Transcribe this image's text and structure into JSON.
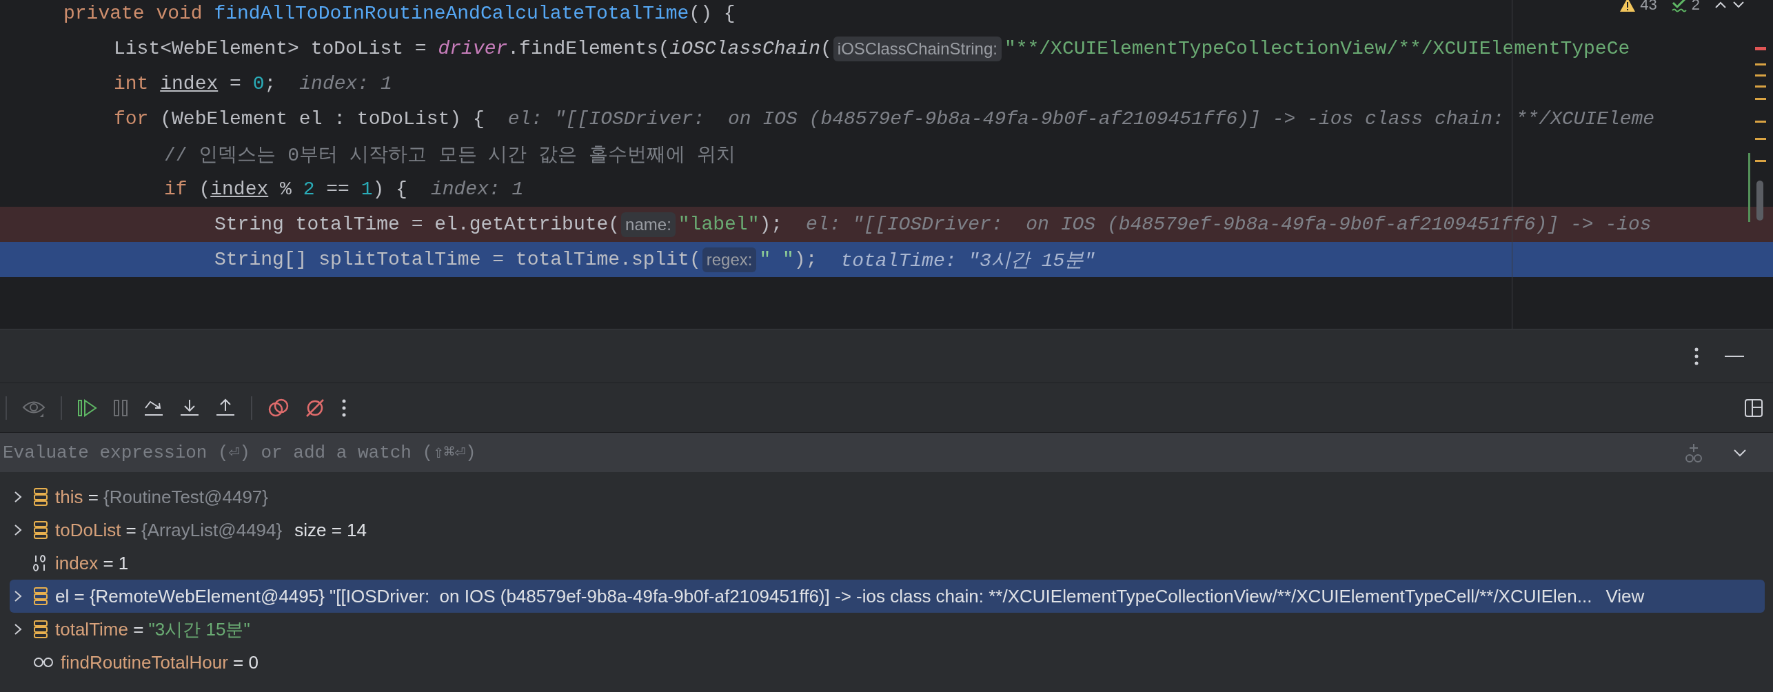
{
  "editor": {
    "indicators": [
      {
        "kind": "warning",
        "count": "43"
      },
      {
        "kind": "weak-warning",
        "count": "2"
      }
    ],
    "lines": [
      {
        "breakpoint": false,
        "current": false,
        "tokens": [
          {
            "kind": "keyword",
            "text": "private "
          },
          {
            "kind": "keyword",
            "text": "void "
          },
          {
            "kind": "declaration",
            "text": "findAllToDoInRoutineAndCalculateTotalTime"
          },
          {
            "kind": "plain",
            "text": "() {"
          }
        ],
        "children": [
          {
            "breakpoint": false,
            "current": false,
            "tokens": [
              {
                "kind": "plain",
                "text": "List<WebElement> toDoList = "
              },
              {
                "kind": "field",
                "text": "driver"
              },
              {
                "kind": "plain",
                "text": ".findElements("
              },
              {
                "kind": "static",
                "text": "iOSClassChain"
              },
              {
                "kind": "plain",
                "text": "("
              },
              {
                "kind": "hint",
                "text": "iOSClassChainString:"
              },
              {
                "kind": "string",
                "text": "\"**/XCUIElementTypeCollectionView/**/XCUIElementTypeCe"
              }
            ]
          },
          {
            "breakpoint": false,
            "current": false,
            "tokens": [
              {
                "kind": "keyword",
                "text": "int "
              },
              {
                "kind": "variable",
                "text": "index"
              },
              {
                "kind": "plain",
                "text": " = "
              },
              {
                "kind": "number",
                "text": "0"
              },
              {
                "kind": "plain",
                "text": ";"
              },
              {
                "kind": "inlay",
                "text": "index: 1"
              }
            ]
          },
          {
            "breakpoint": false,
            "current": false,
            "tokens": [
              {
                "kind": "keyword",
                "text": "for "
              },
              {
                "kind": "plain",
                "text": "(WebElement el : toDoList) {"
              },
              {
                "kind": "inlay",
                "text": "el: \"[[IOSDriver:  on IOS (b48579ef-9b8a-49fa-9b0f-af2109451ff6)] -> -ios class chain: **/XCUIEleme"
              }
            ],
            "children": [
              {
                "breakpoint": false,
                "current": false,
                "tokens": [
                  {
                    "kind": "comment",
                    "text": "// 인덱스는 0부터 시작하고 모든 시간 값은 홀수번째에 위치"
                  }
                ]
              },
              {
                "breakpoint": false,
                "current": false,
                "tokens": [
                  {
                    "kind": "keyword",
                    "text": "if "
                  },
                  {
                    "kind": "plain",
                    "text": "("
                  },
                  {
                    "kind": "variable",
                    "text": "index"
                  },
                  {
                    "kind": "plain",
                    "text": " % "
                  },
                  {
                    "kind": "number",
                    "text": "2"
                  },
                  {
                    "kind": "plain",
                    "text": " == "
                  },
                  {
                    "kind": "number",
                    "text": "1"
                  },
                  {
                    "kind": "plain",
                    "text": ") {"
                  },
                  {
                    "kind": "inlay",
                    "text": "index: 1"
                  }
                ],
                "children": [
                  {
                    "breakpoint": true,
                    "current": false,
                    "tokens": [
                      {
                        "kind": "plain",
                        "text": "String totalTime = el.getAttribute("
                      },
                      {
                        "kind": "hint",
                        "text": "name:"
                      },
                      {
                        "kind": "string",
                        "text": "\"label\""
                      },
                      {
                        "kind": "plain",
                        "text": ");"
                      },
                      {
                        "kind": "inlay",
                        "text": "el: \"[[IOSDriver:  on IOS (b48579ef-9b8a-49fa-9b0f-af2109451ff6)] -> -ios"
                      }
                    ]
                  },
                  {
                    "breakpoint": false,
                    "current": true,
                    "tokens": [
                      {
                        "kind": "plain",
                        "text": "String[] splitTotalTime = totalTime.split("
                      },
                      {
                        "kind": "hint",
                        "text": "regex:"
                      },
                      {
                        "kind": "string",
                        "text": "\" \""
                      },
                      {
                        "kind": "plain",
                        "text": ");"
                      },
                      {
                        "kind": "inlay",
                        "text": "totalTime: \"3시간 15분\""
                      }
                    ]
                  }
                ]
              }
            ]
          }
        ]
      }
    ]
  },
  "debugger": {
    "toolbar": [
      {
        "kind": "watches",
        "disabled": true
      },
      {
        "kind": "resume",
        "disabled": false
      },
      {
        "kind": "pause",
        "disabled": true
      },
      {
        "kind": "step-over",
        "disabled": false
      },
      {
        "kind": "step-into",
        "disabled": false
      },
      {
        "kind": "step-out",
        "disabled": false
      },
      {
        "kind": "view-breakpoints",
        "disabled": false
      },
      {
        "kind": "mute-breakpoints",
        "disabled": false
      },
      {
        "kind": "more",
        "disabled": false
      }
    ],
    "evaluate": {
      "placeholder": "Evaluate expression (⏎) or add a watch (⇧⌘⏎)"
    },
    "variables": [
      {
        "kind": "object",
        "expandable": true,
        "selected": false,
        "name": "this",
        "sign": "=",
        "reference": "{RoutineTest@4497}"
      },
      {
        "kind": "object",
        "expandable": true,
        "selected": false,
        "name": "toDoList",
        "sign": "=",
        "reference": "{ArrayList@4494}",
        "extra": "size = 14"
      },
      {
        "kind": "primitive",
        "expandable": false,
        "selected": false,
        "name": "index",
        "sign": "=",
        "value": "1"
      },
      {
        "kind": "object",
        "expandable": true,
        "selected": true,
        "name": "el",
        "sign": "=",
        "value": "{RemoteWebElement@4495} \"[[IOSDriver:  on IOS (b48579ef-9b8a-49fa-9b0f-af2109451ff6)] -> -ios class chain: **/XCUIElementTypeCollectionView/**/XCUIElementTypeCell/**/XCUIElen...",
        "link": "View"
      },
      {
        "kind": "object",
        "expandable": true,
        "selected": false,
        "name": "totalTime",
        "sign": "=",
        "string": "\"3시간 15분\""
      },
      {
        "kind": "watch",
        "expandable": false,
        "selected": false,
        "name": "findRoutineTotalHour",
        "sign": "=",
        "value": "0"
      }
    ]
  }
}
